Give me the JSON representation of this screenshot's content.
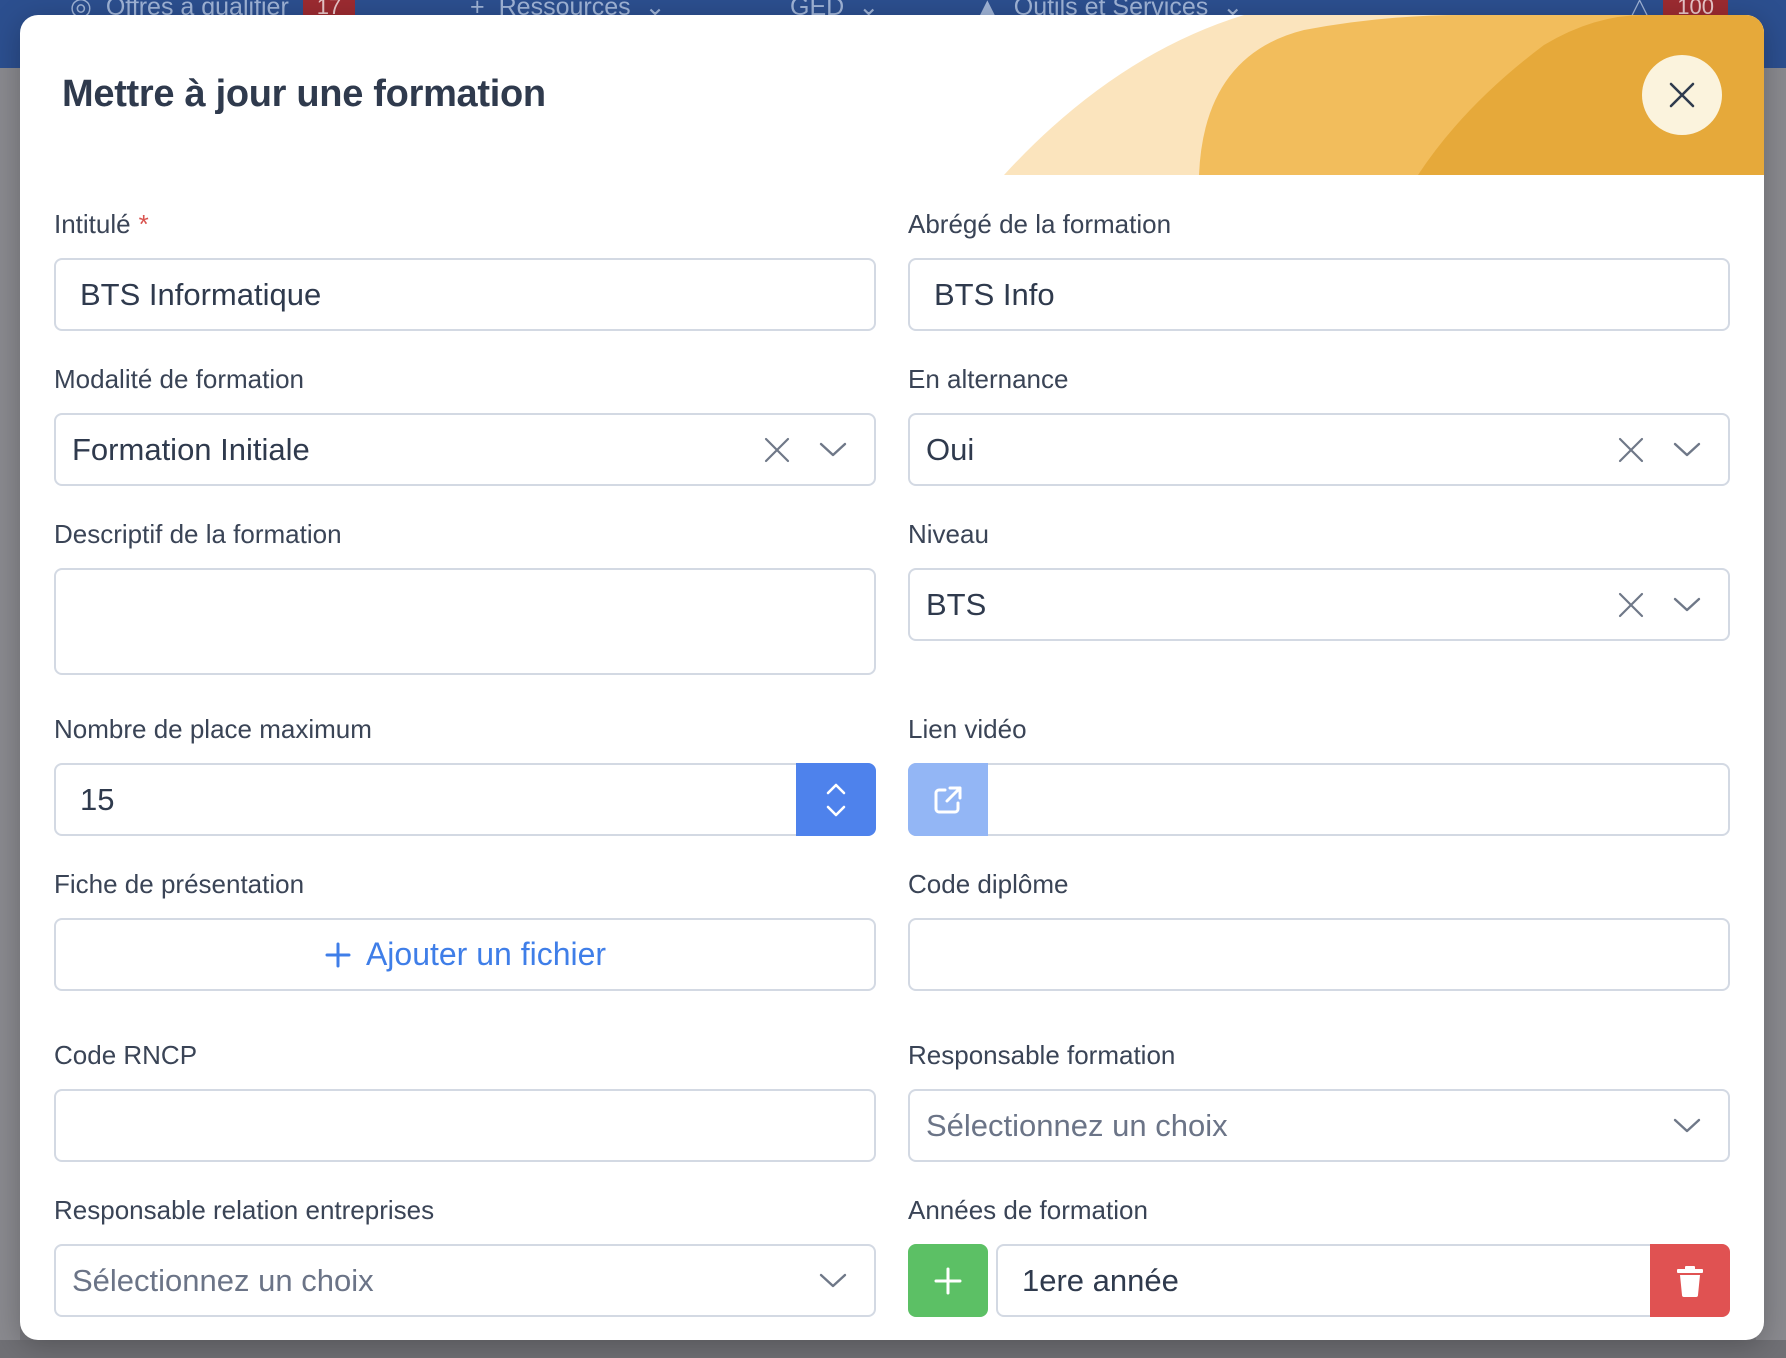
{
  "background": {
    "nav_items": [
      "Offres à qualifier",
      "Ressources",
      "GED",
      "Outils et Services"
    ],
    "offers_badge": "17",
    "notif_badge": "100"
  },
  "modal": {
    "title": "Mettre à jour une formation",
    "colors": {
      "primary": "#4e82ec",
      "success": "#5cc065",
      "danger": "#e05252",
      "required": "#d9534f",
      "accent_yellow": "#efb13a"
    }
  },
  "form": {
    "intitule": {
      "label": "Intitulé",
      "required_mark": "*",
      "value": "BTS Informatique"
    },
    "abrege": {
      "label": "Abrégé de la formation",
      "value": "BTS Info"
    },
    "modalite": {
      "label": "Modalité de formation",
      "value": "Formation Initiale"
    },
    "alternance": {
      "label": "En alternance",
      "value": "Oui"
    },
    "descriptif": {
      "label": "Descriptif de la formation",
      "value": ""
    },
    "niveau": {
      "label": "Niveau",
      "value": "BTS"
    },
    "places": {
      "label": "Nombre de place maximum",
      "value": "15"
    },
    "video": {
      "label": "Lien vidéo",
      "value": ""
    },
    "fiche": {
      "label": "Fiche de présentation",
      "button_label": "Ajouter un fichier"
    },
    "code_diplome": {
      "label": "Code diplôme",
      "value": ""
    },
    "code_rncp": {
      "label": "Code RNCP",
      "value": ""
    },
    "responsable": {
      "label": "Responsable formation",
      "placeholder": "Sélectionnez un choix"
    },
    "responsable_entreprises": {
      "label": "Responsable relation entreprises",
      "placeholder": "Sélectionnez un choix"
    },
    "annees": {
      "label": "Années de formation",
      "value": "1ere année"
    }
  }
}
